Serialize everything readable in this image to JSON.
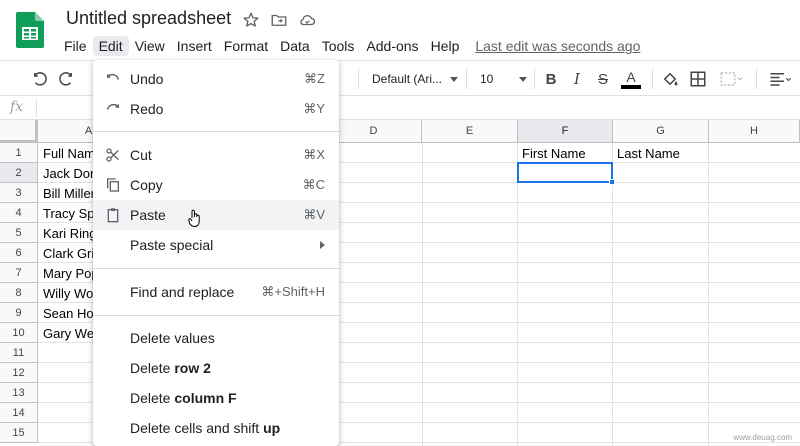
{
  "app": {
    "doc_title": "Untitled spreadsheet",
    "title_icons": [
      "star-icon",
      "move-to-folder-icon",
      "cloud-status-icon"
    ],
    "brand_color": "#0f9d58"
  },
  "menubar": {
    "items": [
      "File",
      "Edit",
      "View",
      "Insert",
      "Format",
      "Data",
      "Tools",
      "Add-ons",
      "Help"
    ],
    "active": "Edit",
    "last_edit": "Last edit was seconds ago"
  },
  "toolbar": {
    "font_family": "Default (Ari...",
    "font_size": "10",
    "icons": [
      "undo-icon",
      "redo-icon",
      "bold-icon",
      "italic-icon",
      "strikethrough-icon",
      "text-color-icon",
      "fill-color-icon",
      "borders-icon",
      "merge-cells-icon",
      "align-left-icon"
    ],
    "text_color_swatch": "#000000"
  },
  "formula_bar": {
    "fx": "fx",
    "value": ""
  },
  "grid": {
    "columns": [
      "A",
      "D",
      "E",
      "F",
      "G",
      "H"
    ],
    "rows": [
      "1",
      "2",
      "3",
      "4",
      "5",
      "6",
      "7",
      "8",
      "9",
      "10",
      "11",
      "12",
      "13",
      "14",
      "15"
    ],
    "selected_column": "F",
    "selected_row": "2",
    "column_a_values": [
      "Full Nam",
      "Jack Dor",
      "Bill Miller",
      "Tracy Sp",
      "Kari Ring",
      "Clark Gri",
      "Mary Pop",
      "Willy Wo",
      "Sean Ho",
      "Gary We"
    ],
    "f1": "First Name",
    "g1": "Last Name",
    "accent": "#1a73e8"
  },
  "edit_menu": {
    "items": [
      {
        "label": "Undo",
        "shortcut": "⌘Z",
        "icon": "undo-icon"
      },
      {
        "label": "Redo",
        "shortcut": "⌘Y",
        "icon": "redo-icon"
      },
      {
        "label": "Cut",
        "shortcut": "⌘X",
        "icon": "scissors-icon"
      },
      {
        "label": "Copy",
        "shortcut": "⌘C",
        "icon": "copy-icon"
      },
      {
        "label": "Paste",
        "shortcut": "⌘V",
        "icon": "clipboard-icon"
      },
      {
        "label": "Paste special",
        "shortcut": "",
        "icon": "chevron-right-icon"
      },
      {
        "label": "Find and replace",
        "shortcut": "⌘+Shift+H"
      },
      {
        "label": "Delete values",
        "shortcut": ""
      },
      {
        "label_prefix": "Delete ",
        "label_bold": "row 2"
      },
      {
        "label_prefix": "Delete ",
        "label_bold": "column F"
      },
      {
        "label_prefix": "Delete cells and shift ",
        "label_bold": "up"
      }
    ],
    "hovered": "Paste"
  },
  "watermark": "www.deuag.com"
}
